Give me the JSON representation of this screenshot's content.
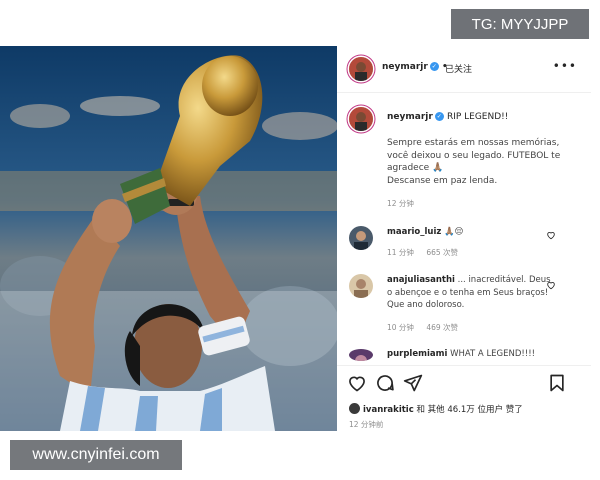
{
  "watermarks": {
    "top": "TG: MYYJJPP",
    "bottom": "www.cnyinfei.com"
  },
  "post": {
    "username": "neymarjr",
    "follow_label": "已关注",
    "more_label": "•••",
    "caption": {
      "title": "RIP LEGEND!!",
      "lines": [
        "Sempre estarás em nossas memórias,",
        "você deixou o seu legado. FUTEBOL te",
        "agradece 🙏🏽",
        "Descanse em paz lenda."
      ],
      "time": "12 分钟"
    },
    "comments": [
      {
        "user": "maario_luiz",
        "text": "🙏🏽😔",
        "time": "11 分钟",
        "likes": "665 次赞"
      },
      {
        "user": "anajuliasanthi",
        "text": "... inacreditável. Deus o abençoe e o tenha em Seus braços! Que ano doloroso.",
        "time": "10 分钟",
        "likes": "469 次赞"
      },
      {
        "user": "purplemiami",
        "text": "WHAT A LEGEND!!!!",
        "time": "",
        "likes": ""
      }
    ],
    "liked_by": {
      "user": "ivanrakitic",
      "rest": "和 其他 46.1万 位用户 赞了"
    },
    "post_time": "12 分钟前"
  },
  "icons": [
    "heart-icon",
    "comment-icon",
    "share-icon",
    "bookmark-icon",
    "verified-badge-icon",
    "small-heart-icon"
  ],
  "colors": {
    "verified": "#3897f0",
    "watermark_bg": "#6f7277",
    "text": "#262626",
    "muted": "#8e8e8e"
  }
}
